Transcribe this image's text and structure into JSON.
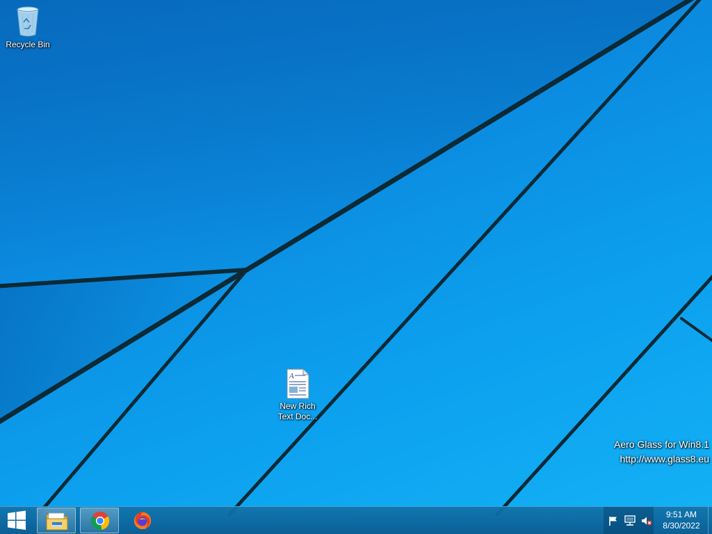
{
  "desktop": {
    "icons": [
      {
        "label": "Recycle Bin",
        "icon": "recycle-bin-icon"
      },
      {
        "label": "New Rich Text Doc...",
        "icon": "rich-text-document-icon"
      }
    ],
    "watermark": {
      "line1": "Aero Glass for Win8.1",
      "line2": "http://www.glass8.eu"
    }
  },
  "taskbar": {
    "start_icon": "windows-logo-icon",
    "pinned": [
      {
        "app": "File Explorer",
        "icon": "file-explorer-icon"
      },
      {
        "app": "Google Chrome",
        "icon": "chrome-icon"
      },
      {
        "app": "Firefox",
        "icon": "firefox-icon"
      }
    ],
    "tray": {
      "icons": [
        "action-center-flag-icon",
        "network-icon",
        "volume-muted-icon"
      ]
    },
    "clock": {
      "time": "9:51 AM",
      "date": "8/30/2022"
    }
  },
  "colors": {
    "wallpaper_blue": "#0b8be0",
    "taskbar": "#0d5f96",
    "text": "#ffffff"
  }
}
